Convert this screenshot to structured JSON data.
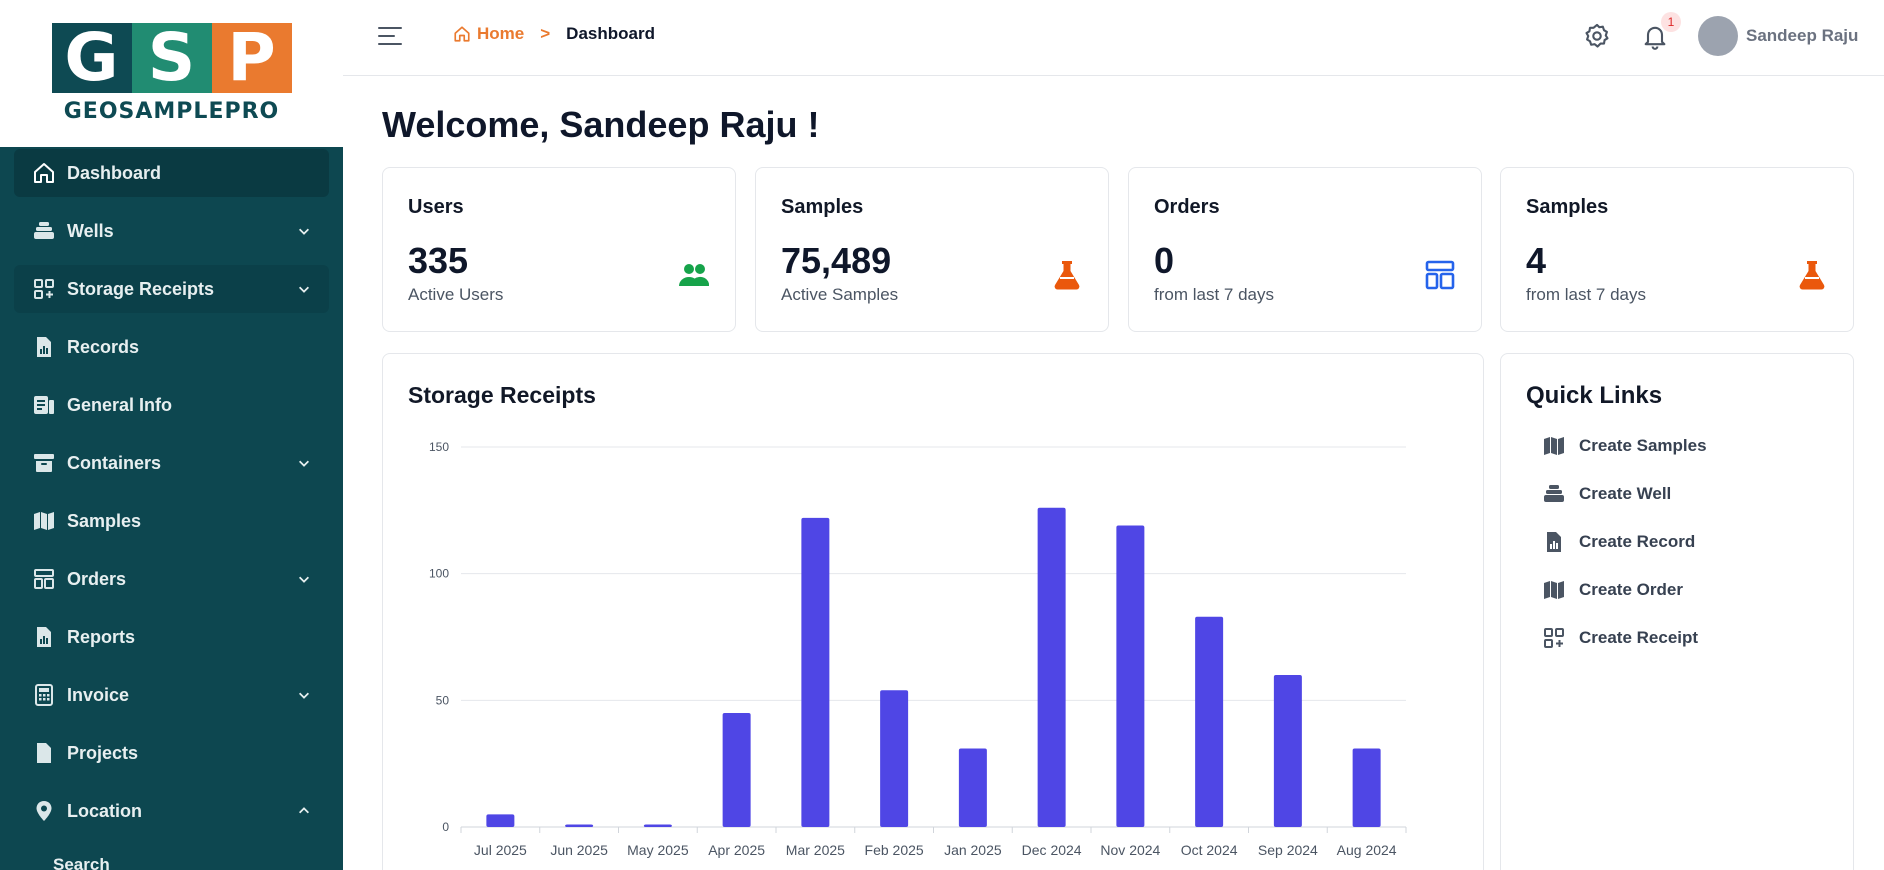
{
  "logo": {
    "letters": [
      "G",
      "S",
      "P"
    ],
    "text": "GeoSamplePro"
  },
  "sidebar": {
    "items": [
      {
        "label": "Dashboard",
        "icon": "home-icon",
        "chevron": ""
      },
      {
        "label": "Wells",
        "icon": "wells-icon",
        "chevron": "down"
      },
      {
        "label": "Storage Receipts",
        "icon": "grid-plus-icon",
        "chevron": "down"
      },
      {
        "label": "Records",
        "icon": "records-icon",
        "chevron": ""
      },
      {
        "label": "General Info",
        "icon": "info-card-icon",
        "chevron": ""
      },
      {
        "label": "Containers",
        "icon": "archive-icon",
        "chevron": "down"
      },
      {
        "label": "Samples",
        "icon": "samples-icon",
        "chevron": ""
      },
      {
        "label": "Orders",
        "icon": "layout-icon",
        "chevron": "down"
      },
      {
        "label": "Reports",
        "icon": "report-icon",
        "chevron": ""
      },
      {
        "label": "Invoice",
        "icon": "calculator-icon",
        "chevron": "down"
      },
      {
        "label": "Projects",
        "icon": "file-icon",
        "chevron": ""
      },
      {
        "label": "Location",
        "icon": "location-pin-icon",
        "chevron": "up"
      }
    ],
    "sub_item": "Search"
  },
  "header": {
    "breadcrumb_home": "Home",
    "breadcrumb_sep": ">",
    "breadcrumb_current": "Dashboard",
    "notification_count": "1",
    "user_name": "Sandeep Raju"
  },
  "welcome": "Welcome, Sandeep Raju !",
  "stats": [
    {
      "title": "Users",
      "value": "335",
      "sub": "Active Users",
      "icon": "users-icon",
      "color": "#16a34a"
    },
    {
      "title": "Samples",
      "value": "75,489",
      "sub": "Active Samples",
      "icon": "flask-icon",
      "color": "#ea580c"
    },
    {
      "title": "Orders",
      "value": "0",
      "sub": "from last 7 days",
      "icon": "layout-icon",
      "color": "#2563eb"
    },
    {
      "title": "Samples",
      "value": "4",
      "sub": "from last 7 days",
      "icon": "flask-icon",
      "color": "#ea580c"
    }
  ],
  "chart_title": "Storage Receipts",
  "chart_data": {
    "type": "bar",
    "title": "Storage Receipts",
    "categories": [
      "Jul 2025",
      "Jun 2025",
      "May 2025",
      "Apr 2025",
      "Mar 2025",
      "Feb 2025",
      "Jan 2025",
      "Dec 2024",
      "Nov 2024",
      "Oct 2024",
      "Sep 2024",
      "Aug 2024"
    ],
    "values": [
      5,
      1,
      1,
      45,
      122,
      54,
      31,
      126,
      119,
      83,
      60,
      31
    ],
    "yticks": [
      0,
      50,
      100,
      150
    ],
    "ylim": [
      0,
      150
    ],
    "color": "#4f46e5",
    "grid": true
  },
  "quick_links": {
    "title": "Quick Links",
    "items": [
      {
        "label": "Create Samples",
        "icon": "samples-icon"
      },
      {
        "label": "Create Well",
        "icon": "wells-icon"
      },
      {
        "label": "Create Record",
        "icon": "records-icon"
      },
      {
        "label": "Create Order",
        "icon": "samples-icon"
      },
      {
        "label": "Create Receipt",
        "icon": "grid-plus-icon"
      }
    ]
  }
}
